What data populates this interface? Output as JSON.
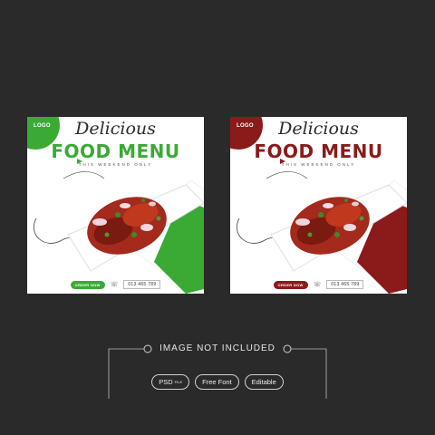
{
  "cards": [
    {
      "logo": "LOGO",
      "script_title": "Delicious",
      "title": "FOOD MENU",
      "subtitle": "THIS WEEKEND ONLY",
      "order_label": "ORDER NOW",
      "phone": "013 465 789",
      "accent": "#3aaa35"
    },
    {
      "logo": "LOGO",
      "script_title": "Delicious",
      "title": "FOOD MENU",
      "subtitle": "THIS WEEKEND ONLY",
      "order_label": "ORDER NOW",
      "phone": "013 465 789",
      "accent": "#8b1a1a"
    }
  ],
  "caption": {
    "title": "IMAGE NOT INCLUDED",
    "tags": [
      {
        "label": "PSD",
        "suffix": "FILE"
      },
      {
        "label": "Free Font"
      },
      {
        "label": "Editable"
      }
    ]
  },
  "icons": [
    "phone-icon"
  ],
  "background_color": "#2a2a2a"
}
